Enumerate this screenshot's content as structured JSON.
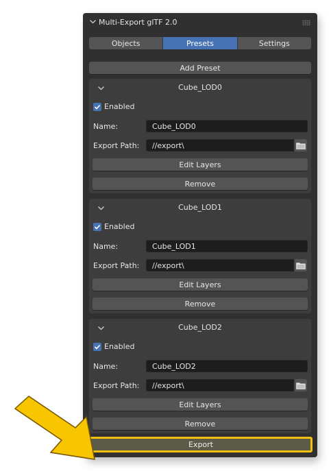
{
  "panel": {
    "title": "Multi-Export glTF 2.0",
    "tabs": [
      {
        "label": "Objects"
      },
      {
        "label": "Presets"
      },
      {
        "label": "Settings"
      }
    ],
    "active_tab": "Presets",
    "add_preset_label": "Add Preset",
    "export_label": "Export",
    "accent_color": "#4772b3",
    "highlight_color": "#f3c10d"
  },
  "presets": [
    {
      "title": "Cube_LOD0",
      "enabled_label": "Enabled",
      "enabled": true,
      "name_label": "Name:",
      "name_value": "Cube_LOD0",
      "path_label": "Export Path:",
      "path_value": "//export\\",
      "edit_layers_label": "Edit Layers",
      "remove_label": "Remove"
    },
    {
      "title": "Cube_LOD1",
      "enabled_label": "Enabled",
      "enabled": true,
      "name_label": "Name:",
      "name_value": "Cube_LOD1",
      "path_label": "Export Path:",
      "path_value": "//export\\",
      "edit_layers_label": "Edit Layers",
      "remove_label": "Remove"
    },
    {
      "title": "Cube_LOD2",
      "enabled_label": "Enabled",
      "enabled": true,
      "name_label": "Name:",
      "name_value": "Cube_LOD2",
      "path_label": "Export Path:",
      "path_value": "//export\\",
      "edit_layers_label": "Edit Layers",
      "remove_label": "Remove"
    }
  ],
  "icons": {
    "header": "chevron-down-icon",
    "preset": "chevron-down-icon",
    "checkbox": "checkmark-icon",
    "folder": "folder-icon",
    "drag": "drag-handle-icon",
    "callout": "arrow-icon"
  }
}
